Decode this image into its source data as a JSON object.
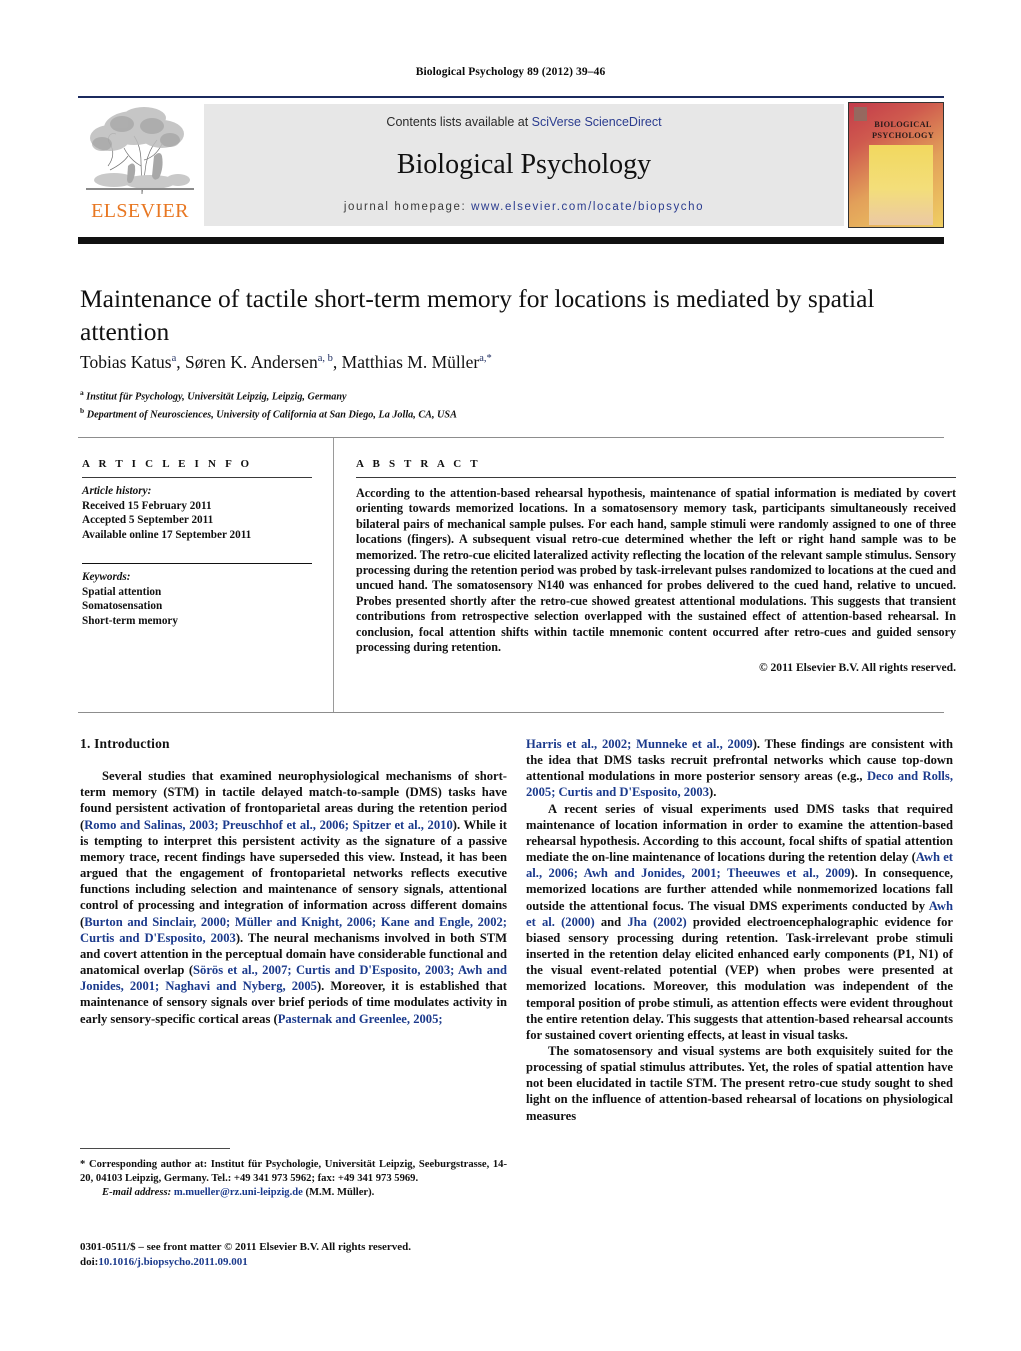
{
  "running_head": "Biological Psychology 89 (2012) 39–46",
  "masthead": {
    "contents_prefix": "Contents lists available at ",
    "contents_link": "SciVerse ScienceDirect",
    "journal_title": "Biological Psychology",
    "homepage_prefix": "journal homepage: ",
    "homepage_url": "www.elsevier.com/locate/biopsycho",
    "publisher_logo_text": "ELSEVIER",
    "cover": {
      "line1": "BIOLOGICAL",
      "line2": "PSYCHOLOGY"
    }
  },
  "article": {
    "title": "Maintenance of tactile short-term memory for locations is mediated by spatial attention",
    "authors_html": "Tobias Katus<sup>a</sup>, Søren K. Andersen<sup>a, b</sup>, Matthias M. Müller<sup>a,*</sup>",
    "affiliation_a": "Institut für Psychology, Universität Leipzig, Leipzig, Germany",
    "affiliation_b": "Department of Neurosciences, University of California at San Diego, La Jolla, CA, USA"
  },
  "info": {
    "heading": "A R T I C L E   I N F O",
    "history_label": "Article history:",
    "history": [
      "Received 15 February 2011",
      "Accepted 5 September 2011",
      "Available online 17 September 2011"
    ],
    "keywords_label": "Keywords:",
    "keywords": [
      "Spatial attention",
      "Somatosensation",
      "Short-term memory"
    ]
  },
  "abstract": {
    "heading": "A B S T R A C T",
    "text": "According to the attention-based rehearsal hypothesis, maintenance of spatial information is mediated by covert orienting towards memorized locations. In a somatosensory memory task, participants simultaneously received bilateral pairs of mechanical sample pulses. For each hand, sample stimuli were randomly assigned to one of three locations (fingers). A subsequent visual retro-cue determined whether the left or right hand sample was to be memorized. The retro-cue elicited lateralized activity reflecting the location of the relevant sample stimulus. Sensory processing during the retention period was probed by task-irrelevant pulses randomized to locations at the cued and uncued hand. The somatosensory N140 was enhanced for probes delivered to the cued hand, relative to uncued. Probes presented shortly after the retro-cue showed greatest attentional modulations. This suggests that transient contributions from retrospective selection overlapped with the sustained effect of attention-based rehearsal. In conclusion, focal attention shifts within tactile mnemonic content occurred after retro-cues and guided sensory processing during retention.",
    "copyright": "© 2011 Elsevier B.V. All rights reserved."
  },
  "body": {
    "section_heading": "1.  Introduction",
    "left_p1_a": "Several studies that examined neurophysiological mechanisms of short-term memory (STM) in tactile delayed match-to-sample (DMS) tasks have found persistent activation of frontoparietal areas during the retention period (",
    "left_p1_cite1": "Romo and Salinas, 2003; Preuschhof et al., 2006; Spitzer et al., 2010",
    "left_p1_b": "). While it is tempting to interpret this persistent activity as the signature of a passive memory trace, recent findings have superseded this view. Instead, it has been argued that the engagement of frontoparietal networks reflects executive functions including selection and maintenance of sensory signals, attentional control of processing and integration of information across different domains (",
    "left_p1_cite2": "Burton and Sinclair, 2000; Müller and Knight, 2006; Kane and Engle, 2002; Curtis and D'Esposito, 2003",
    "left_p1_c": "). The neural mechanisms involved in both STM and covert attention in the perceptual domain have considerable functional and anatomical overlap (",
    "left_p1_cite3": "Sörös et al., 2007; Curtis and D'Esposito, 2003; Awh and Jonides, 2001; Naghavi and Nyberg, 2005",
    "left_p1_d": "). Moreover, it is established that maintenance of sensory signals over brief periods of time modulates activity in early sensory-specific cortical areas (",
    "left_p1_cite4": "Pasternak and Greenlee, 2005;",
    "right_p1_cite1": "Harris et al., 2002; Munneke et al., 2009",
    "right_p1_a": "). These findings are consistent with the idea that DMS tasks recruit prefrontal networks which cause top-down attentional modulations in more posterior sensory areas (e.g., ",
    "right_p1_cite2": "Deco and Rolls, 2005; Curtis and D'Esposito, 2003",
    "right_p1_b": ").",
    "right_p2_a": "A recent series of visual experiments used DMS tasks that required maintenance of location information in order to examine the attention-based rehearsal hypothesis. According to this account, focal shifts of spatial attention mediate the on-line maintenance of locations during the retention delay (",
    "right_p2_cite1": "Awh et al., 2006; Awh and Jonides, 2001; Theeuwes et al., 2009",
    "right_p2_b": "). In consequence, memorized locations are further attended while nonmemorized locations fall outside the attentional focus. The visual DMS experiments conducted by ",
    "right_p2_cite2": "Awh et al. (2000)",
    "right_p2_c": " and ",
    "right_p2_cite3": "Jha (2002)",
    "right_p2_d": " provided electroencephalographic evidence for biased sensory processing during retention. Task-irrelevant probe stimuli inserted in the retention delay elicited enhanced early components (P1, N1) of the visual event-related potential (VEP) when probes were presented at memorized locations. Moreover, this modulation was independent of the temporal position of probe stimuli, as attention effects were evident throughout the entire retention delay. This suggests that attention-based rehearsal accounts for sustained covert orienting effects, at least in visual tasks.",
    "right_p3": "The somatosensory and visual systems are both exquisitely suited for the processing of spatial stimulus attributes. Yet, the roles of spatial attention have not been elucidated in tactile STM. The present retro-cue study sought to shed light on the influence of attention-based rehearsal of locations on physiological measures"
  },
  "footnotes": {
    "corresponding": "* Corresponding author at: Institut für Psychologie, Universität Leipzig, Seeburgstrasse, 14-20, 04103 Leipzig, Germany. Tel.: +49 341 973 5962; fax: +49 341 973 5969.",
    "email_label": "E-mail address:",
    "email": "m.mueller@rz.uni-leipzig.de",
    "email_suffix": " (M.M. Müller).",
    "issn_line": "0301-0511/$ – see front matter © 2011 Elsevier B.V. All rights reserved.",
    "doi_label": "doi:",
    "doi": "10.1016/j.biopsycho.2011.09.001"
  },
  "colors": {
    "link_blue": "#2b3c8f",
    "citation_blue": "#1b3a8c",
    "elsevier_orange": "#E87722",
    "band_gray": "#e7e7e7"
  }
}
